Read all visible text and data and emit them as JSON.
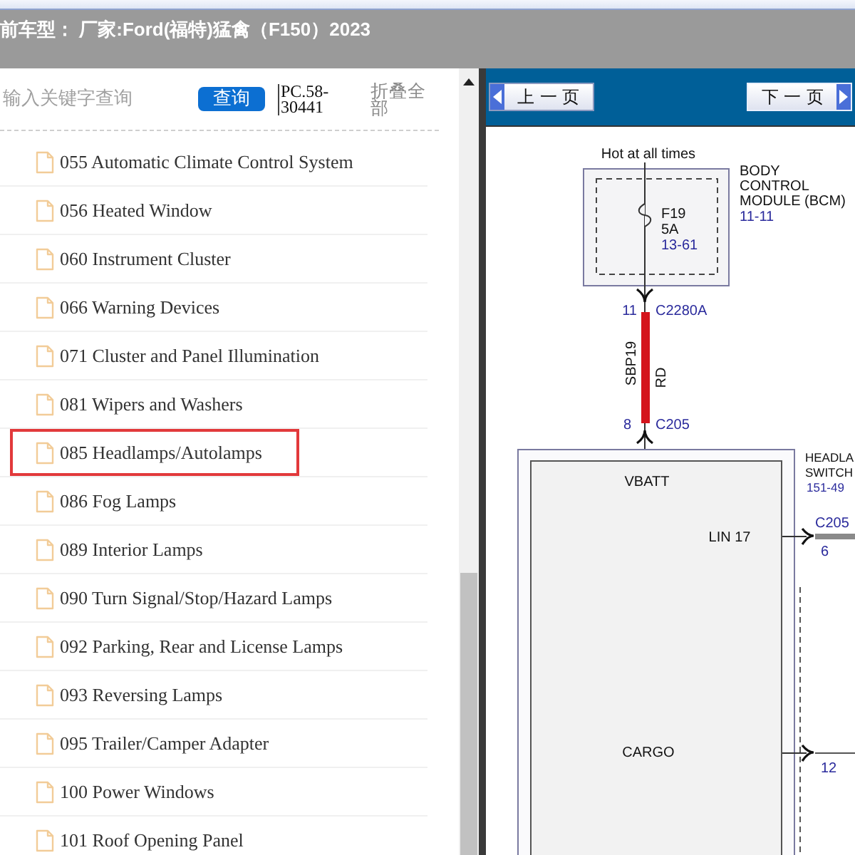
{
  "header": {
    "title": "前车型： 厂家:Ford(福特)猛禽（F150）2023"
  },
  "sidebar": {
    "search": {
      "placeholder": "输入关键字查询"
    },
    "search_button": "查询",
    "code": "PC.58-30441",
    "collapse_all": "折叠全部",
    "items": [
      {
        "label": "055 Automatic Climate Control System",
        "selected": false
      },
      {
        "label": "056 Heated Window",
        "selected": false
      },
      {
        "label": "060 Instrument Cluster",
        "selected": false
      },
      {
        "label": "066 Warning Devices",
        "selected": false
      },
      {
        "label": "071 Cluster and Panel Illumination",
        "selected": false
      },
      {
        "label": "081 Wipers and Washers",
        "selected": false
      },
      {
        "label": "085 Headlamps/Autolamps",
        "selected": true
      },
      {
        "label": "086 Fog Lamps",
        "selected": false
      },
      {
        "label": "089 Interior Lamps",
        "selected": false
      },
      {
        "label": "090 Turn Signal/Stop/Hazard Lamps",
        "selected": false
      },
      {
        "label": "092 Parking, Rear and License Lamps",
        "selected": false
      },
      {
        "label": "093 Reversing Lamps",
        "selected": false
      },
      {
        "label": "095 Trailer/Camper Adapter",
        "selected": false
      },
      {
        "label": "100 Power Windows",
        "selected": false
      },
      {
        "label": "101 Roof Opening Panel",
        "selected": false
      }
    ]
  },
  "viewer": {
    "prev_button": "上 一 页",
    "next_button": "下 一 页",
    "diagram": {
      "supply_label": "Hot at all times",
      "fuse": {
        "name": "F19",
        "rating": "5A",
        "ref": "13-61"
      },
      "module": {
        "lines": [
          "BODY",
          "CONTROL",
          "MODULE (BCM)"
        ],
        "ref": "11-11"
      },
      "upper_connector": {
        "pin": "11",
        "name": "C2280A"
      },
      "wire": {
        "circuit": "SBP19",
        "color_code": "RD"
      },
      "lower_connector": {
        "pin": "8",
        "name": "C205"
      },
      "switch": {
        "lines": [
          "HEADLA",
          "SWITCH"
        ],
        "ref": "151-49",
        "vbatt": "VBATT",
        "lin": "LIN 17",
        "cargo": "CARGO"
      },
      "outputs": [
        {
          "connector": "C205",
          "pin": "6",
          "kind": "thick"
        },
        {
          "pin": "12",
          "kind": "thin"
        }
      ]
    }
  }
}
